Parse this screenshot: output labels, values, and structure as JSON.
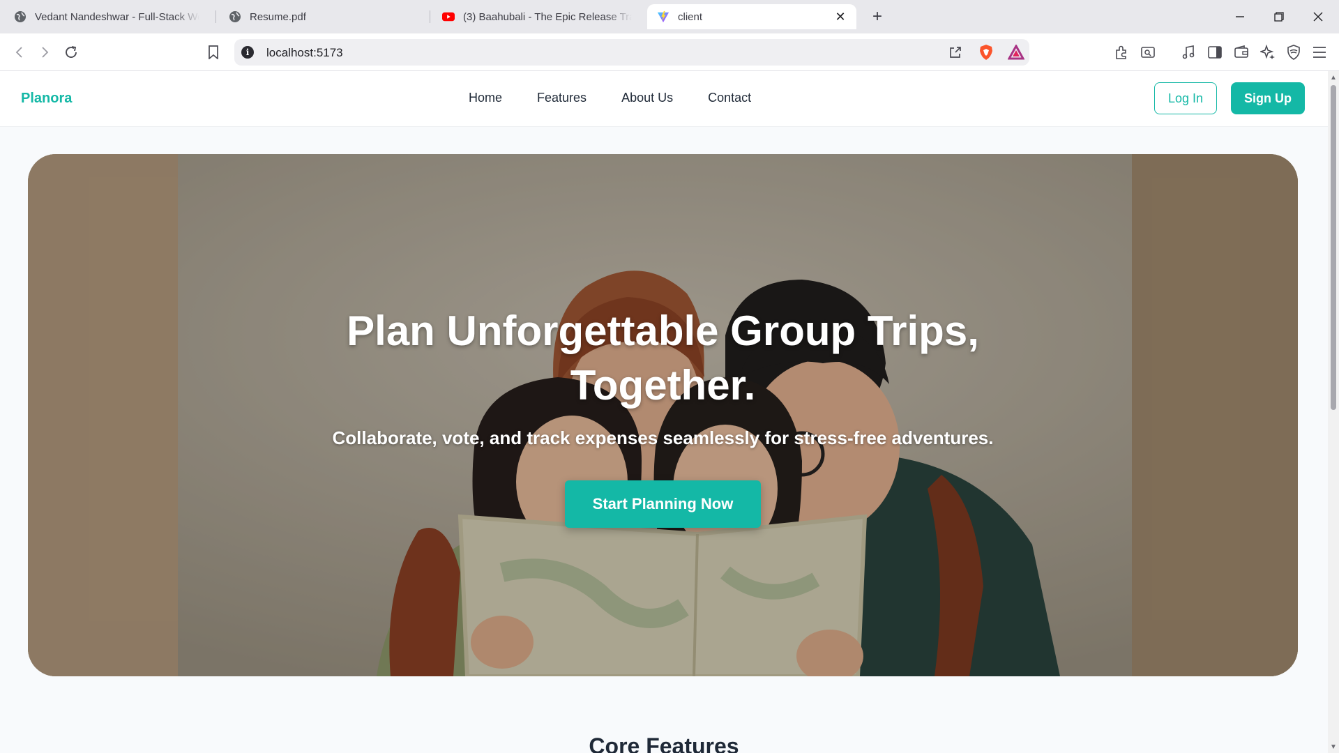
{
  "browser": {
    "tabs": [
      {
        "title": "Vedant Nandeshwar - Full-Stack Web",
        "icon": "globe-icon"
      },
      {
        "title": "Resume.pdf",
        "icon": "globe-icon"
      },
      {
        "title": "(3) Baahubali - The Epic Release Traile",
        "icon": "youtube-icon"
      },
      {
        "title": "client",
        "icon": "vite-icon"
      }
    ],
    "address": "localhost:5173"
  },
  "page": {
    "brand": "Planora",
    "nav": [
      "Home",
      "Features",
      "About Us",
      "Contact"
    ],
    "login_label": "Log In",
    "signup_label": "Sign Up",
    "hero": {
      "title_line1": "Plan Unforgettable Group Trips,",
      "title_line2": "Together.",
      "subtitle": "Collaborate, vote, and track expenses seamlessly for stress-free adventures.",
      "cta_label": "Start Planning Now"
    },
    "section_heading": "Core Features"
  },
  "colors": {
    "accent": "#14b8a6",
    "nav_text": "#1f2937",
    "tabstrip": "#e8e8ec"
  }
}
